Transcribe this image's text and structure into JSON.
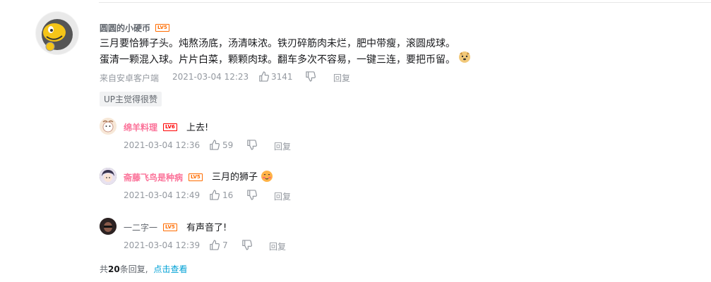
{
  "main_comment": {
    "username": "圆圆的小硬币",
    "level": "LV5",
    "line1": "三月要恰狮子头。炖熬汤底，汤清味浓。铁刃碎筋肉未烂，肥中带瘦，滚圆成球。",
    "line2": "蛋清一颗混入球。片片白菜，颗颗肉球。翻车多次不容易，一键三连，要把币留。",
    "source": "来自安卓客户端",
    "time": "2021-03-04 12:23",
    "likes": "3141",
    "reply_label": "回复",
    "up_tag": "UP主觉得很赞"
  },
  "replies": [
    {
      "username": "绵羊料理",
      "level": "LV6",
      "text": "上去!",
      "time": "2021-03-04 12:36",
      "likes": "59",
      "reply_label": "回复"
    },
    {
      "username": "斋藤飞鸟是种病",
      "level": "LV5",
      "text": "三月的狮子",
      "time": "2021-03-04 12:49",
      "likes": "16",
      "reply_label": "回复"
    },
    {
      "username": "一二字一",
      "level": "LV5",
      "text": "有声音了!",
      "time": "2021-03-04 12:39",
      "likes": "7",
      "reply_label": "回复"
    }
  ],
  "footer": {
    "prefix": "共",
    "count": "20",
    "suffix": "条回复,",
    "link": "点击查看"
  },
  "colors": {
    "pink_name": "#fb7299",
    "gray_name": "#61666d",
    "lv6": "#ff0000",
    "lv5": "#ff6c00",
    "meta": "#9499a0",
    "link": "#00a1d6"
  }
}
